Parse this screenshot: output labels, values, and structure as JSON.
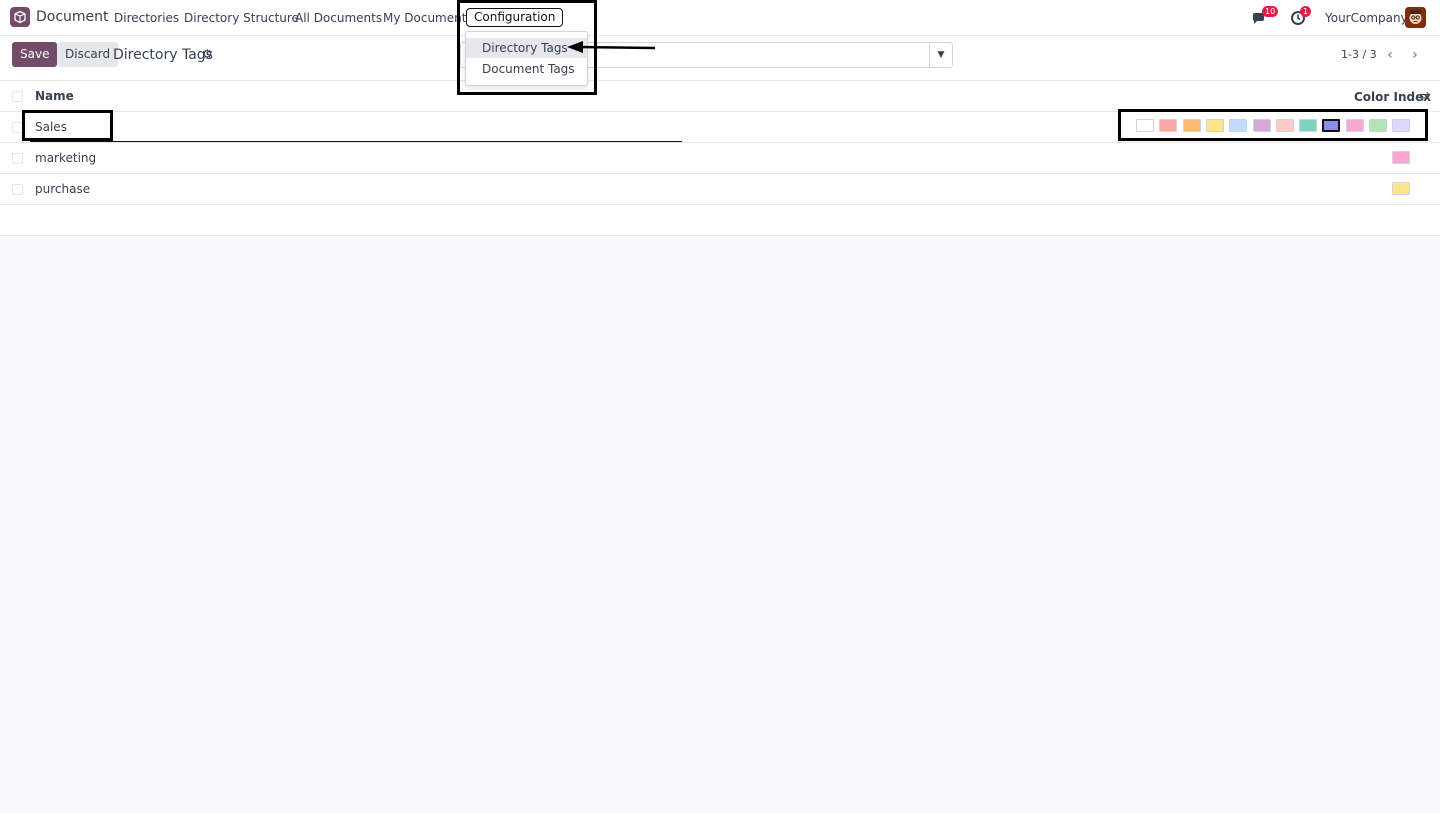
{
  "navbar": {
    "app_name": "Document",
    "items": [
      "Directories",
      "Directory Structure",
      "All Documents",
      "My Documents"
    ],
    "config_label": "Configuration",
    "messages_badge": "10",
    "activity_badge": "1",
    "company": "YourCompany"
  },
  "control": {
    "save_label": "Save",
    "discard_label": "Discard",
    "breadcrumb": "Directory Tags",
    "pager": "1-3 / 3"
  },
  "dropdown": {
    "items": [
      "Directory Tags",
      "Document Tags"
    ]
  },
  "list": {
    "headers": {
      "name": "Name",
      "color": "Color Index"
    },
    "rows": [
      {
        "name": "Sales",
        "color": "",
        "editing": true
      },
      {
        "name": "marketing",
        "color": "#f9a8d4"
      },
      {
        "name": "purchase",
        "color": "#fde68a"
      }
    ],
    "palette": [
      "#ffffff",
      "#fca5a5",
      "#fdba74",
      "#fde68a",
      "#bfdbfe",
      "#d8a8d8",
      "#fecaca",
      "#7dd3c0",
      "#8b8bea",
      "#f9a8d4",
      "#b6e3b6",
      "#ddd6fe"
    ],
    "selected_palette_index": 8
  }
}
